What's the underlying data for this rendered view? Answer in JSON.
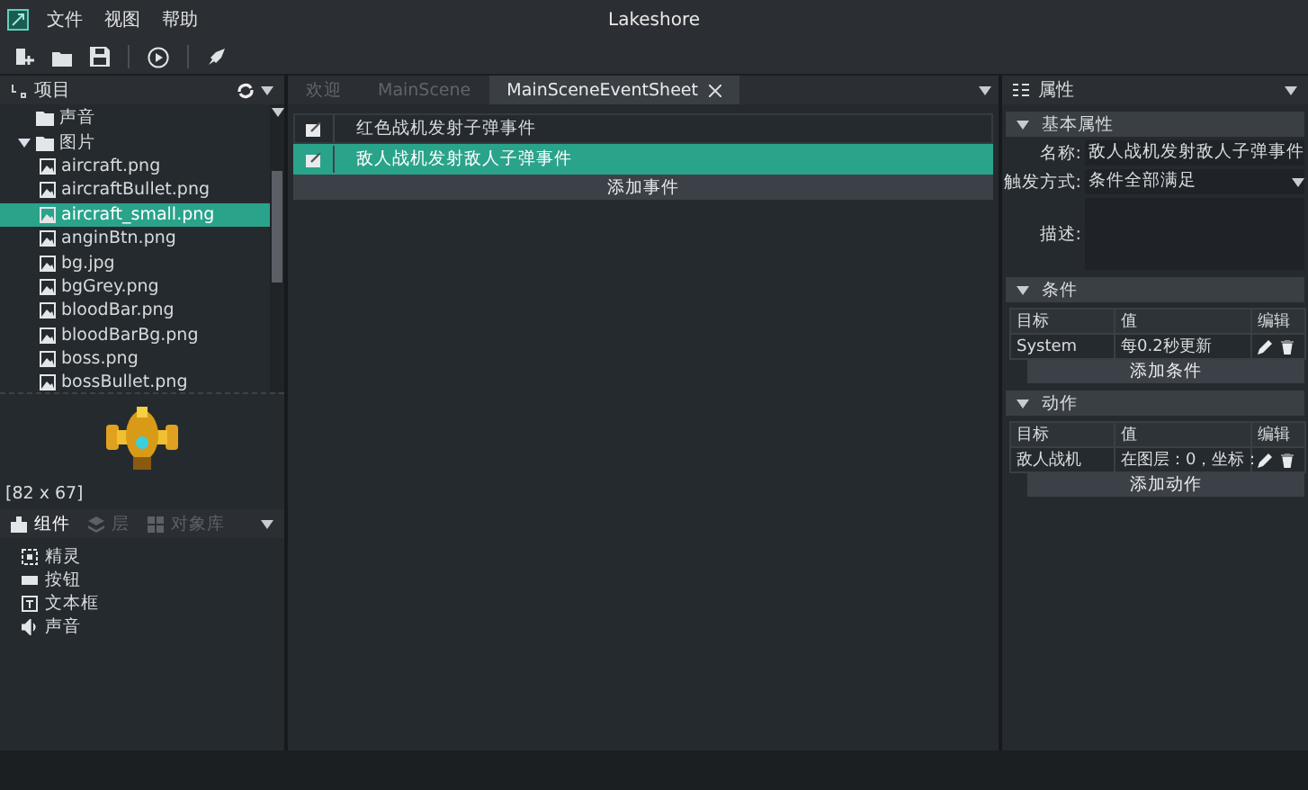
{
  "window": {
    "title": "Lakeshore",
    "menu": [
      "文件",
      "视图",
      "帮助"
    ]
  },
  "project_panel": {
    "title": "项目",
    "tree": [
      {
        "label": "声音",
        "kind": "folder",
        "selected": false
      },
      {
        "label": "图片",
        "kind": "folder",
        "selected": false,
        "children": [
          {
            "label": "aircraft.png",
            "kind": "image",
            "selected": false
          },
          {
            "label": "aircraftBullet.png",
            "kind": "image",
            "selected": false
          },
          {
            "label": "aircraft_small.png",
            "kind": "image",
            "selected": true
          },
          {
            "label": "anginBtn.png",
            "kind": "image",
            "selected": false
          },
          {
            "label": "bg.jpg",
            "kind": "image",
            "selected": false
          },
          {
            "label": "bgGrey.png",
            "kind": "image",
            "selected": false
          },
          {
            "label": "bloodBar.png",
            "kind": "image",
            "selected": false
          },
          {
            "label": "bloodBarBg.png",
            "kind": "image",
            "selected": false
          },
          {
            "label": "boss.png",
            "kind": "image",
            "selected": false
          },
          {
            "label": "bossBullet.png",
            "kind": "image",
            "selected": false
          }
        ]
      }
    ],
    "preview": {
      "size": "[82 x 67]"
    },
    "tabs": [
      {
        "label": "组件",
        "kind": "components",
        "selected": true,
        "disabled": false
      },
      {
        "label": "层",
        "kind": "layers",
        "selected": false,
        "disabled": true
      },
      {
        "label": "对象库",
        "kind": "library",
        "selected": false,
        "disabled": true
      }
    ],
    "components": [
      {
        "label": "精灵",
        "kind": "sprite"
      },
      {
        "label": "按钮",
        "kind": "button"
      },
      {
        "label": "文本框",
        "kind": "textbox"
      },
      {
        "label": "声音",
        "kind": "sound"
      }
    ]
  },
  "editor": {
    "tabs": [
      {
        "label": "欢迎",
        "selected": false,
        "closable": false
      },
      {
        "label": "MainScene",
        "selected": false,
        "closable": false
      },
      {
        "label": "MainSceneEventSheet",
        "selected": true,
        "closable": true
      }
    ],
    "events": [
      {
        "label": "红色战机发射子弹事件",
        "selected": false
      },
      {
        "label": "敌人战机发射敌人子弹事件",
        "selected": true
      }
    ],
    "add_button": "添加事件"
  },
  "properties": {
    "title": "属性",
    "basic": {
      "title": "基本属性",
      "name_label": "名称:",
      "name_value": "敌人战机发射敌人子弹事件",
      "trigger_label": "触发方式:",
      "trigger_value": "条件全部满足",
      "description_label": "描述:"
    },
    "conditions": {
      "title": "条件",
      "columns": [
        "目标",
        "值",
        "编辑"
      ],
      "rows": [
        {
          "target": "System",
          "value": "每0.2秒更新"
        }
      ],
      "add_button": "添加条件"
    },
    "actions": {
      "title": "动作",
      "columns": [
        "目标",
        "值",
        "编辑"
      ],
      "rows": [
        {
          "target": "敌人战机",
          "value": "在图层：0，坐标："
        }
      ],
      "add_button": "添加动作"
    }
  }
}
